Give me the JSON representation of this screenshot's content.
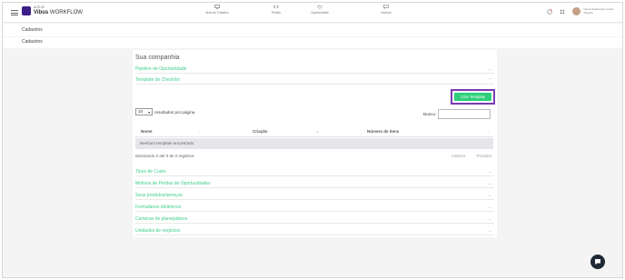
{
  "app": {
    "logo_small": "ACE IN",
    "logo_brand": "Vibus",
    "logo_product": " WORKFLOW"
  },
  "nav": [
    {
      "label": "Área de Trabalho",
      "icon": "monitor-icon"
    },
    {
      "label": "Pedido",
      "icon": "code-icon"
    },
    {
      "label": "Oportunidade",
      "icon": "handshake-icon"
    },
    {
      "label": "Kanban",
      "icon": "chat-icon"
    }
  ],
  "user": {
    "line1": "Nome.Sobrenome.conta",
    "line2": "Suporte"
  },
  "breadcrumbs": {
    "first": "Cadastros",
    "second": "Cadastros"
  },
  "card": {
    "title": "Sua companhia",
    "sections_top": [
      "Pipeline de Oportunidade",
      "Template de Checklist"
    ],
    "create_button": "Criar Template",
    "per_page_value": "10",
    "per_page_label": "resultados por página",
    "search_label": "Busca:",
    "search_value": "",
    "columns": [
      "Nome",
      "Criação",
      "Número de itens"
    ],
    "empty_text": "Nenhum template encontrado",
    "showing_text": "Mostrando 0 até 0 de 0 registros",
    "prev_label": "Anterior",
    "next_label": "Próximo",
    "sections_bottom": [
      "Tipos de Custo",
      "Motivos de Perdas de Oportunidades",
      "Seus produtos/serviços",
      "Formulários dinâmicos",
      "Carteiras de planejadores",
      "Unidades de negócios"
    ]
  },
  "colors": {
    "accent_green": "#3ecf8e",
    "button_green": "#2ecf7a",
    "highlight_purple": "#7a3bb0",
    "brand_purple": "#3b1e86"
  }
}
